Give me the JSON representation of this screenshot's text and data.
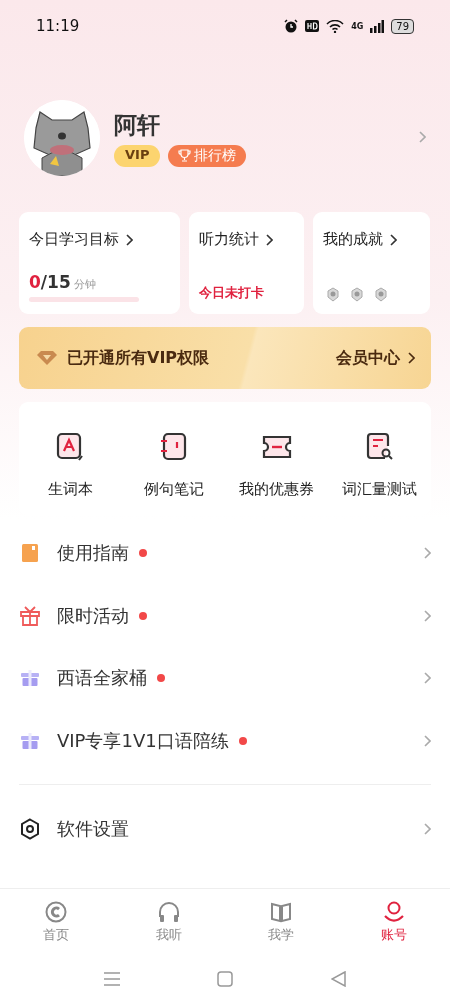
{
  "status_bar": {
    "time": "11:19",
    "network": "4G",
    "battery": "79"
  },
  "profile": {
    "name": "阿轩",
    "vip_badge": "VIP",
    "rank_button": "排行榜"
  },
  "cards": [
    {
      "kind": "goal",
      "title": "今日学习目标",
      "done": "0",
      "total": "/15",
      "unit": "分钟",
      "level": 0
    },
    {
      "kind": "listen",
      "title": "听力统计",
      "status": "今日未打卡"
    },
    {
      "kind": "achieve",
      "title": "我的成就"
    }
  ],
  "vip_banner": {
    "text": "已开通所有VIP权限",
    "link": "会员中心"
  },
  "shortcuts": [
    {
      "label": "生词本"
    },
    {
      "label": "例句笔记"
    },
    {
      "label": "我的优惠券"
    },
    {
      "label": "词汇量测试"
    }
  ],
  "menu": [
    {
      "label": "使用指南",
      "badge": true
    },
    {
      "label": "限时活动",
      "badge": true
    },
    {
      "label": "西语全家桶",
      "badge": true
    },
    {
      "label": "VIP专享1V1口语陪练",
      "badge": true
    }
  ],
  "settings": [
    {
      "label": "软件设置"
    }
  ],
  "tabs": [
    {
      "label": "首页",
      "selected": false
    },
    {
      "label": "我听",
      "selected": false
    },
    {
      "label": "我学",
      "selected": false
    },
    {
      "label": "账号",
      "selected": true
    }
  ]
}
